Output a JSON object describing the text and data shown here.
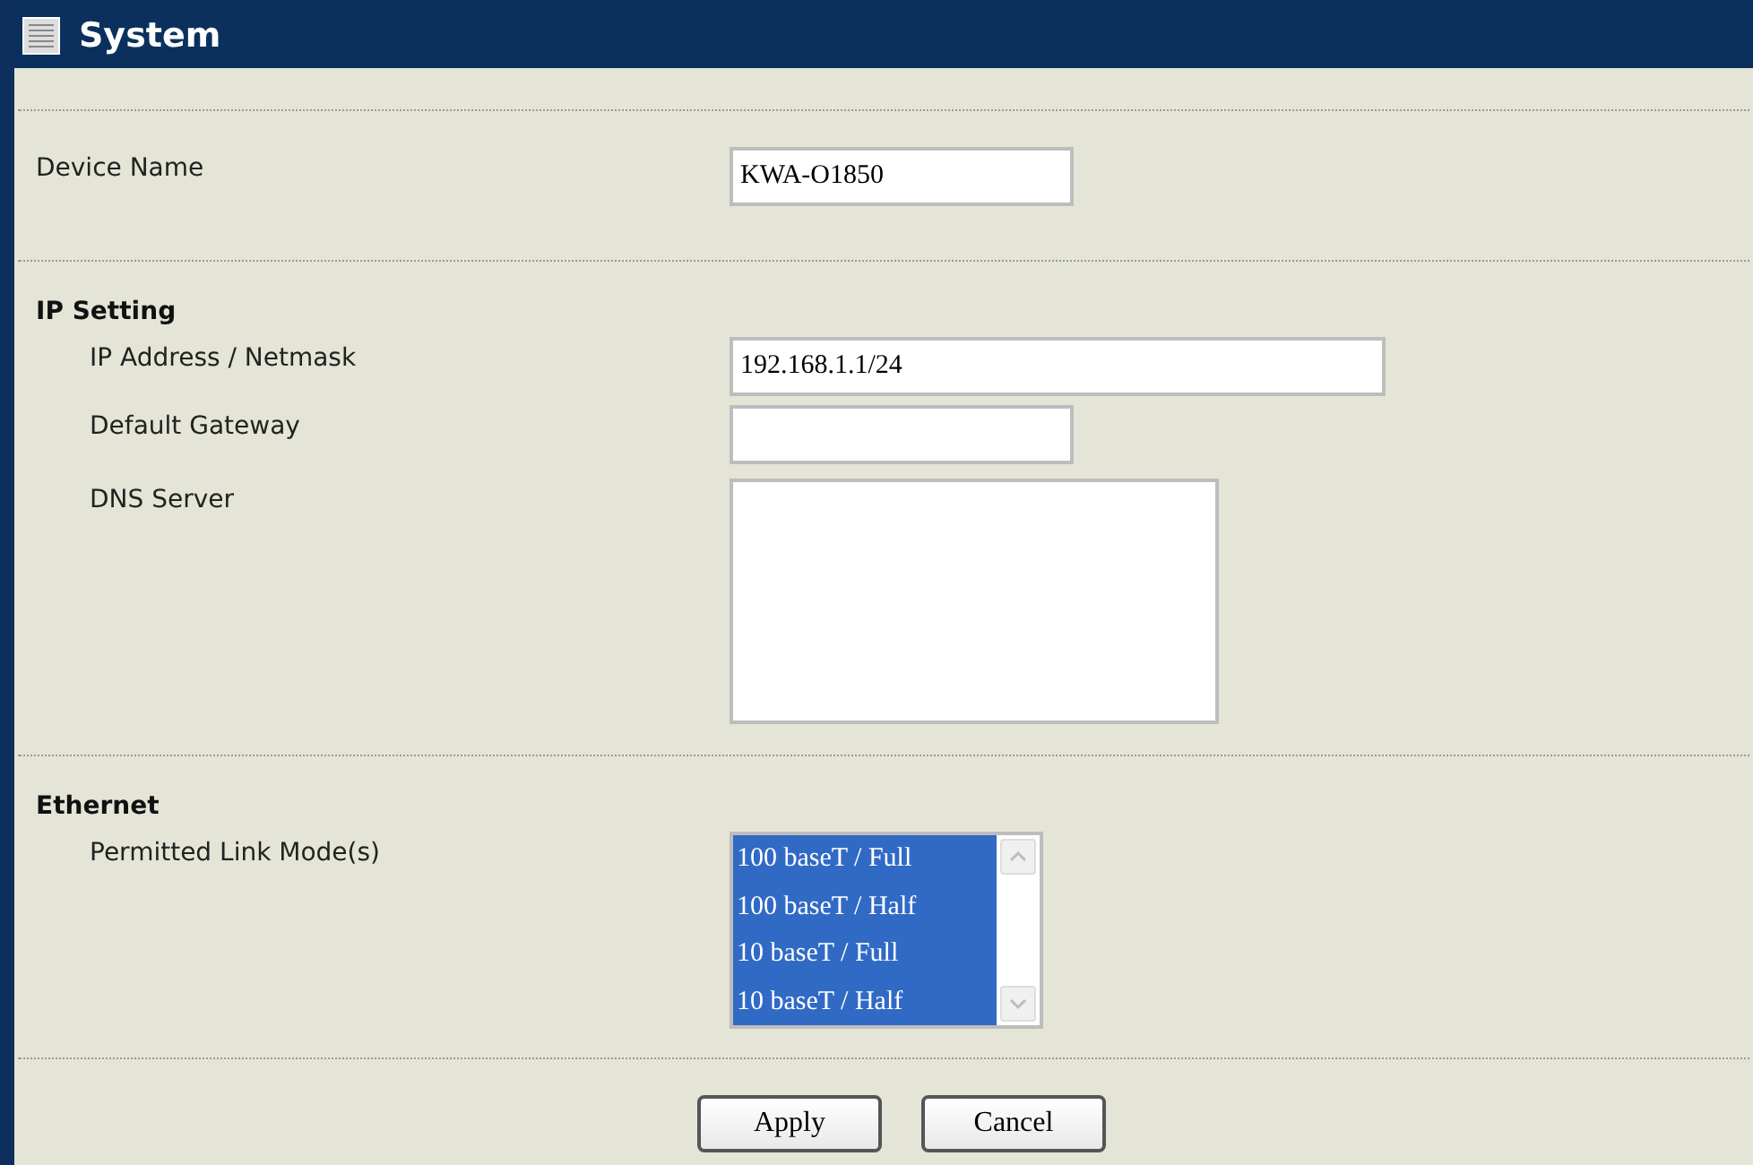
{
  "header": {
    "title": "System"
  },
  "device_name": {
    "label": "Device Name",
    "value": "KWA-O1850"
  },
  "ip_setting": {
    "heading": "IP Setting",
    "ip_address": {
      "label": "IP Address / Netmask",
      "value": "192.168.1.1/24"
    },
    "default_gateway": {
      "label": "Default Gateway"
    },
    "dns_server": {
      "label": "DNS Server"
    }
  },
  "ethernet": {
    "heading": "Ethernet",
    "link_modes": {
      "label": "Permitted Link Mode(s)",
      "options": [
        {
          "label": "100 baseT / Full",
          "selected": true
        },
        {
          "label": "100 baseT / Half",
          "selected": true
        },
        {
          "label": "10 baseT / Full",
          "selected": true
        },
        {
          "label": "10 baseT / Half",
          "selected": true
        }
      ]
    }
  },
  "buttons": [
    "Apply",
    "Cancel"
  ]
}
